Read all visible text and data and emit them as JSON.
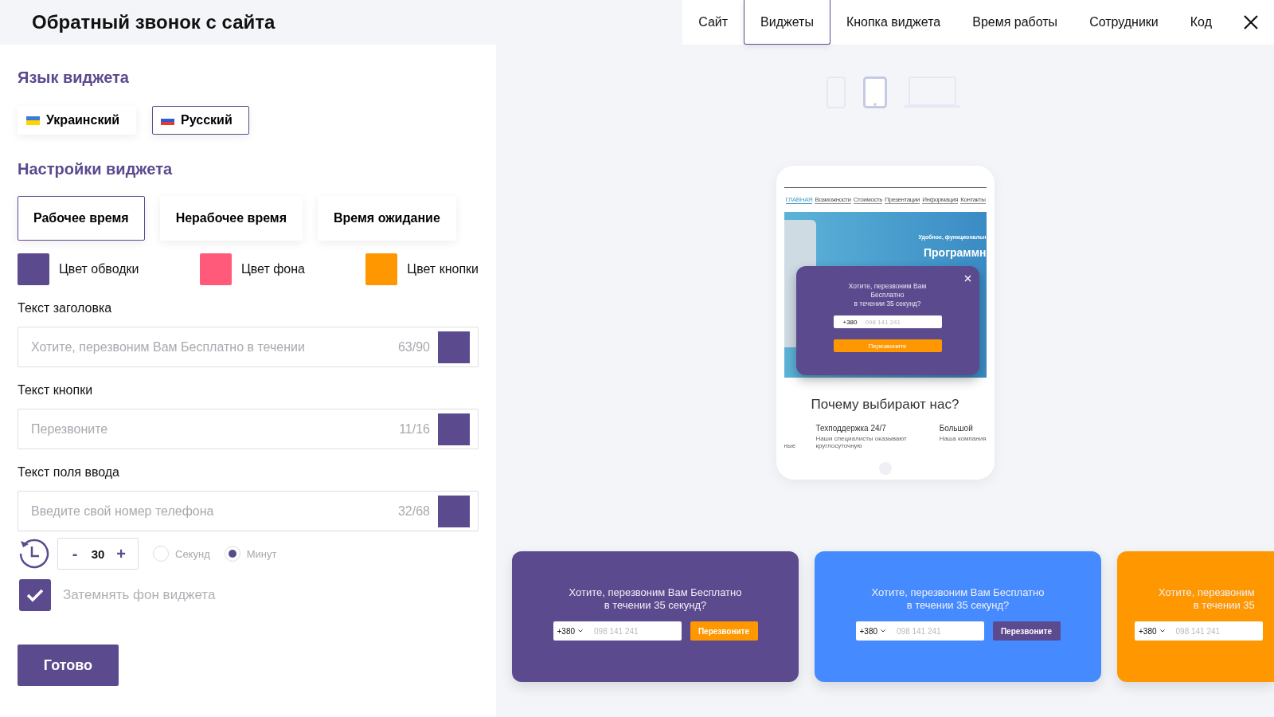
{
  "header": {
    "title": "Обратный звонок с сайта"
  },
  "tabs": [
    {
      "label": "Сайт",
      "selected": false
    },
    {
      "label": "Виджеты",
      "selected": true
    },
    {
      "label": "Кнопка виджета",
      "selected": false
    },
    {
      "label": "Время работы",
      "selected": false
    },
    {
      "label": "Сотрудники",
      "selected": false
    },
    {
      "label": "Код",
      "selected": false
    }
  ],
  "language": {
    "title": "Язык виджета",
    "options": [
      {
        "label": "Украинский",
        "kind": "ua",
        "selected": false
      },
      {
        "label": "Русский",
        "kind": "ru",
        "selected": true
      }
    ]
  },
  "settings": {
    "title": "Настройки виджета",
    "modes": [
      {
        "label": "Рабочее время",
        "selected": true
      },
      {
        "label": "Нерабочее время",
        "selected": false
      },
      {
        "label": "Время ожидание",
        "selected": false
      }
    ],
    "colors": [
      {
        "label": "Цвет обводки",
        "color": "#5c4a8f"
      },
      {
        "label": "Цвет фона",
        "color": "#ff5a7a"
      },
      {
        "label": "Цвет кнопки",
        "color": "#ff9800"
      }
    ],
    "fields": [
      {
        "label": "Текст заголовка",
        "placeholder": "Хотите, перезвоним Вам Бесплатно в течении",
        "counter": "63/90",
        "color": "#5c4a8f"
      },
      {
        "label": "Текст кнопки",
        "placeholder": "Перезвоните",
        "counter": "11/16",
        "color": "#5c4a8f"
      },
      {
        "label": "Текст поля ввода",
        "placeholder": "Введите свой номер телефона",
        "counter": "32/68",
        "color": "#5c4a8f"
      }
    ],
    "timer": {
      "minus": "-",
      "value": "30",
      "plus": "+",
      "units": [
        {
          "label": "Секунд",
          "selected": false
        },
        {
          "label": "Минут",
          "selected": true
        }
      ]
    },
    "darken": {
      "label": "Затемнять фон виджета",
      "checked": true
    },
    "done": "Готово"
  },
  "devices": [
    {
      "kind": "phone",
      "selected": false
    },
    {
      "kind": "tablet",
      "selected": true
    },
    {
      "kind": "laptop",
      "selected": false
    }
  ],
  "preview": {
    "nav": [
      {
        "label": "ГЛАВНАЯ",
        "selected": true
      },
      {
        "label": "Возможности",
        "selected": false
      },
      {
        "label": "Стоимость",
        "selected": false
      },
      {
        "label": "Презентации",
        "selected": false
      },
      {
        "label": "Информация",
        "selected": false
      },
      {
        "label": "Контакты",
        "selected": false
      }
    ],
    "hero_subtitle": "Удобное, функциональн",
    "hero_title": "Программн",
    "popup": {
      "title_lines": [
        "Хотите, перезвоним Вам",
        "Бесплатно",
        "в течении 35 секунд?"
      ],
      "code": "+380",
      "placeholder": "098 141 241",
      "button": "Перезвоните"
    },
    "heading": "Почему выбирают нас?",
    "features": [
      {
        "left": "ные"
      },
      {
        "title": "Техподдержка 24/7",
        "text": "Наши специалисты оказывают круглосуточную"
      },
      {
        "title": "Большой",
        "text": "Наша компания"
      }
    ]
  },
  "cards": [
    {
      "color": "#5c4a8f",
      "title_lines": [
        "Хотите, перезвоним Вам Бесплатно",
        "в течении 35 секунд?"
      ],
      "code": "+380",
      "placeholder": "098 141 241",
      "button": {
        "label": "Перезвоните",
        "color": "#ff9800"
      }
    },
    {
      "color": "#458bff",
      "title_lines": [
        "Хотите, перезвоним Вам Бесплатно",
        "в течении 35 секунд?"
      ],
      "code": "+380",
      "placeholder": "098 141 241",
      "button": {
        "label": "Перезвоните",
        "color": "#5c4a8f"
      }
    },
    {
      "color": "#ff9800",
      "title_lines": [
        "Хотите, перезвоним",
        "в течении 35"
      ],
      "code": "+380",
      "placeholder": "098 141 241"
    }
  ]
}
